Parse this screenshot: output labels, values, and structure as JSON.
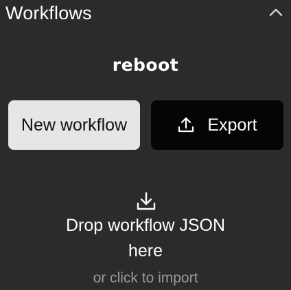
{
  "panel": {
    "title": "Workflows",
    "toggle_icon": "chevron-up-icon"
  },
  "brand": {
    "logo_text": "reboot"
  },
  "actions": {
    "new_workflow_label": "New workflow",
    "export_label": "Export",
    "export_icon": "upload-icon"
  },
  "dropzone": {
    "icon": "download-icon",
    "title_line1": "Drop workflow JSON",
    "title_line2": "here",
    "hint": "or click to import"
  },
  "colors": {
    "background": "#2b2b2b",
    "primary_button_bg": "#e6e6e6",
    "secondary_button_bg": "#050505",
    "hint_text": "#9a9a9a"
  }
}
